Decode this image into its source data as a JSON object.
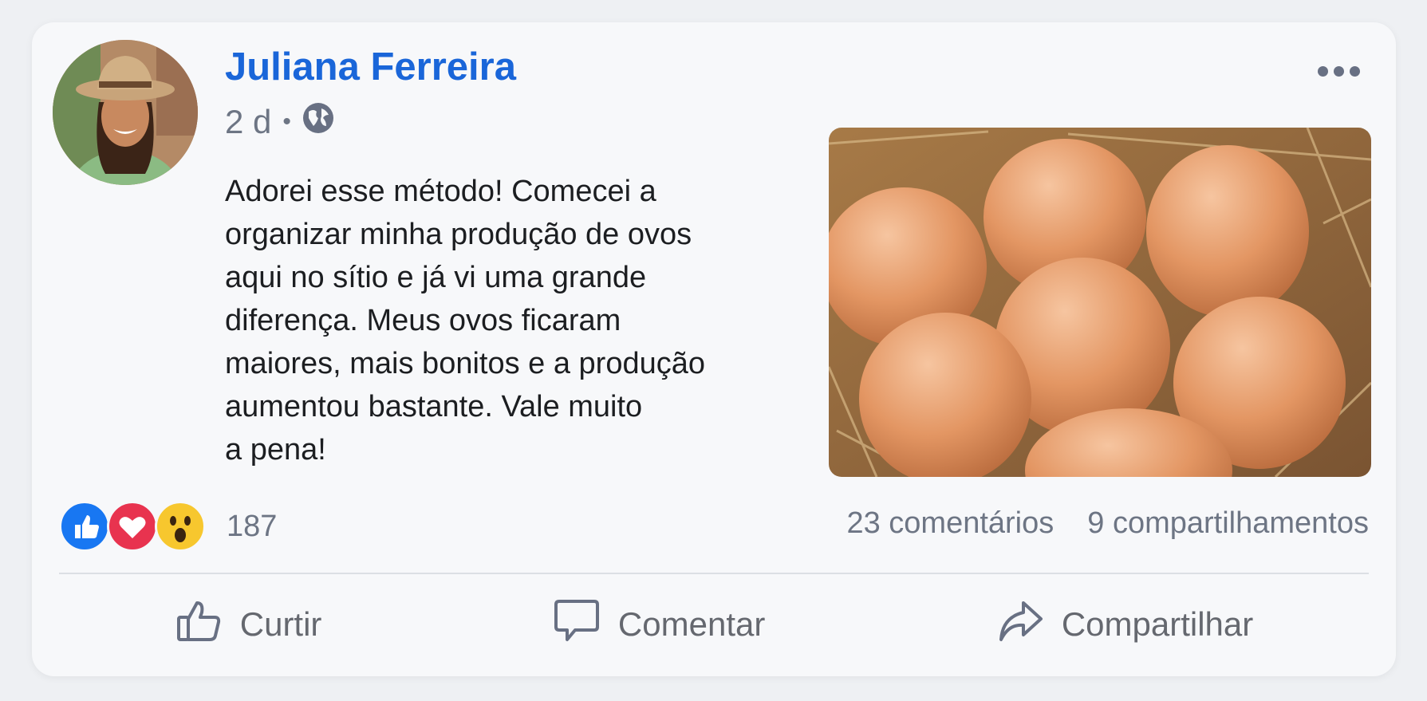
{
  "post": {
    "author": "Juliana Ferreira",
    "time": "2 d",
    "separator": "•",
    "privacy_icon": "globe-icon",
    "text": "Adorei esse método! Comecei a\norganizar minha produção de ovos\naqui no sítio e já vi uma grande\ndiferença. Meus ovos ficaram\nmaiores, mais bonitos e a produção\naumentou bastante. Vale muito\na pena!",
    "image_icon": "eggs-in-nest-photo"
  },
  "reactions": {
    "icons": [
      "like-icon",
      "love-icon",
      "wow-icon"
    ],
    "count": "187"
  },
  "stats": {
    "comments": "23 comentários",
    "shares": "9 compartilhamentos"
  },
  "actions": {
    "like": "Curtir",
    "comment": "Comentar",
    "share": "Compartilhar"
  },
  "colors": {
    "author": "#1a66d9",
    "like": "#1877f2",
    "love": "#e8334f",
    "wow": "#f7c72e",
    "muted": "#6d7584"
  }
}
